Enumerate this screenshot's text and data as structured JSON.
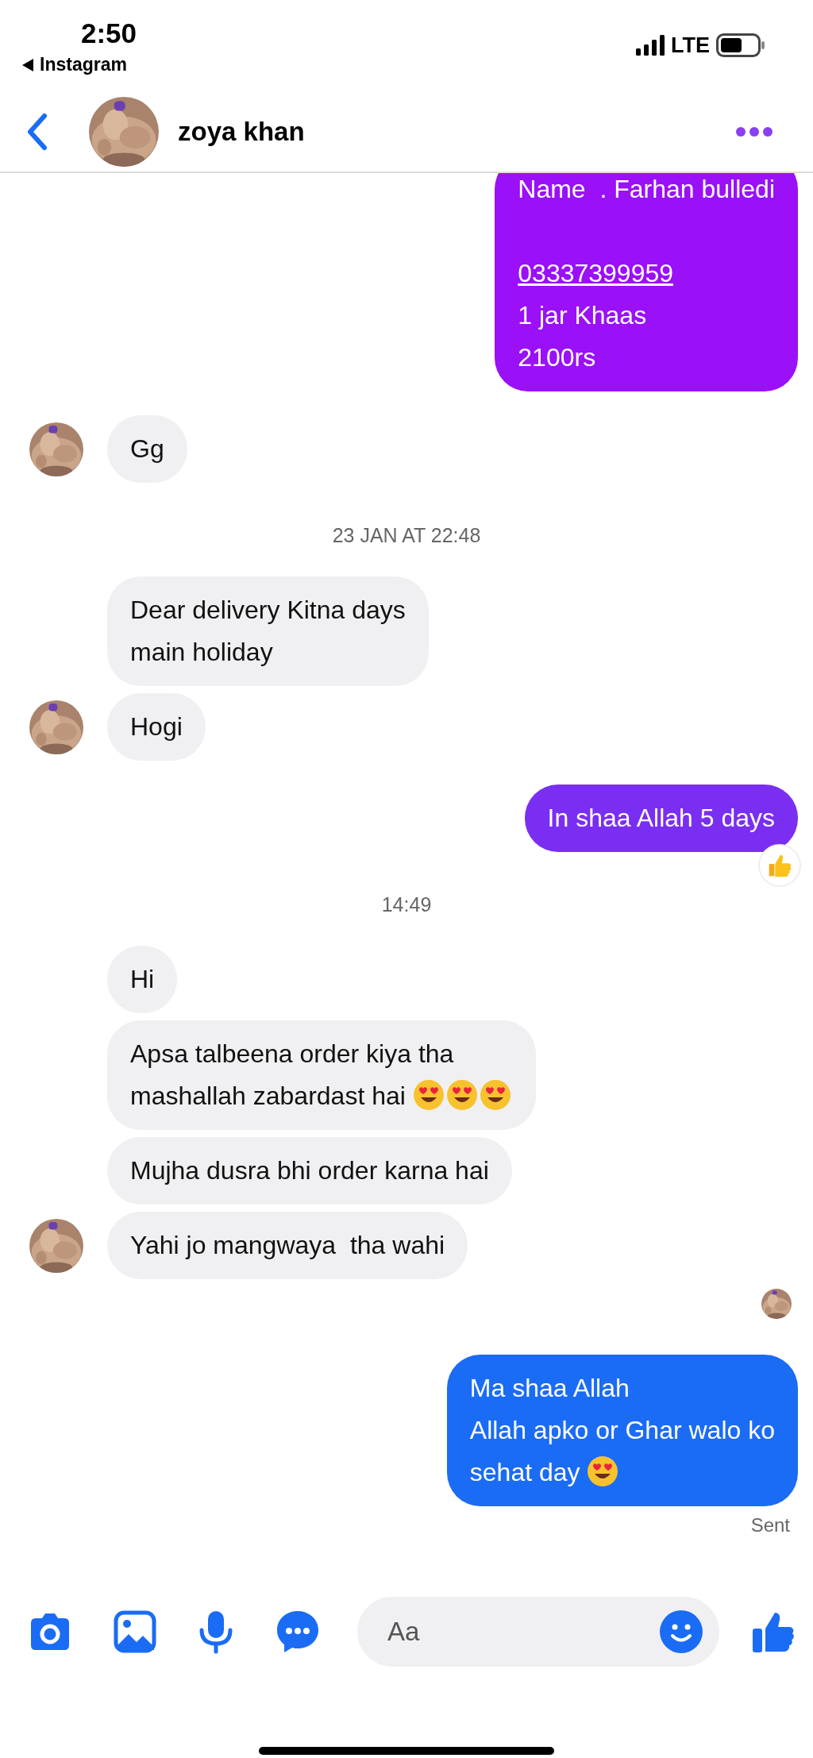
{
  "status_bar": {
    "time": "2:50",
    "back_app": "Instagram",
    "network": "LTE"
  },
  "header": {
    "contact_name": "zoya khan"
  },
  "messages": [
    {
      "kind": "outgoing",
      "color": "#9a10f7",
      "parts": [
        {
          "kind": "text",
          "text": "Name  . Farhan bulledi\n\n"
        },
        {
          "kind": "link",
          "text": "03337399959"
        },
        {
          "kind": "text",
          "text": "\n1 jar Khaas\n2100rs"
        }
      ]
    },
    {
      "kind": "incoming",
      "avatar": true,
      "parts": [
        {
          "kind": "text",
          "text": "Gg"
        }
      ]
    },
    {
      "kind": "timestamp",
      "text": "23 JAN AT 22:48"
    },
    {
      "kind": "incoming",
      "avatar": false,
      "parts": [
        {
          "kind": "text",
          "text": "Dear delivery Kitna days\nmain holiday"
        }
      ]
    },
    {
      "kind": "incoming",
      "avatar": true,
      "parts": [
        {
          "kind": "text",
          "text": "Hogi"
        }
      ]
    },
    {
      "kind": "outgoing",
      "color": "#7a2ef2",
      "reaction": {
        "kind": "thumbs_up"
      },
      "parts": [
        {
          "kind": "text",
          "text": "In shaa Allah 5 days"
        }
      ]
    },
    {
      "kind": "timestamp",
      "text": "14:49"
    },
    {
      "kind": "incoming",
      "avatar": false,
      "parts": [
        {
          "kind": "text",
          "text": "Hi"
        }
      ]
    },
    {
      "kind": "incoming",
      "avatar": false,
      "parts": [
        {
          "kind": "text",
          "text": "Apsa talbeena order kiya tha\nmashallah zabardast hai "
        }
      ],
      "emoji": [
        {
          "kind": "heart_eyes"
        },
        {
          "kind": "heart_eyes"
        },
        {
          "kind": "heart_eyes"
        }
      ]
    },
    {
      "kind": "incoming",
      "avatar": false,
      "parts": [
        {
          "kind": "text",
          "text": "Mujha dusra bhi order karna hai"
        }
      ]
    },
    {
      "kind": "incoming",
      "avatar": true,
      "parts": [
        {
          "kind": "text",
          "text": "Yahi jo mangwaya  tha wahi"
        }
      ]
    },
    {
      "kind": "read_receipt"
    },
    {
      "kind": "outgoing",
      "color": "#1b6cf5",
      "parts": [
        {
          "kind": "text",
          "text": "Ma shaa Allah\nAllah apko or Ghar walo ko\nsehat day "
        }
      ],
      "emoji": [
        {
          "kind": "heart_eyes"
        }
      ]
    },
    {
      "kind": "status",
      "text": "Sent"
    }
  ],
  "composer": {
    "placeholder": "Aa"
  }
}
